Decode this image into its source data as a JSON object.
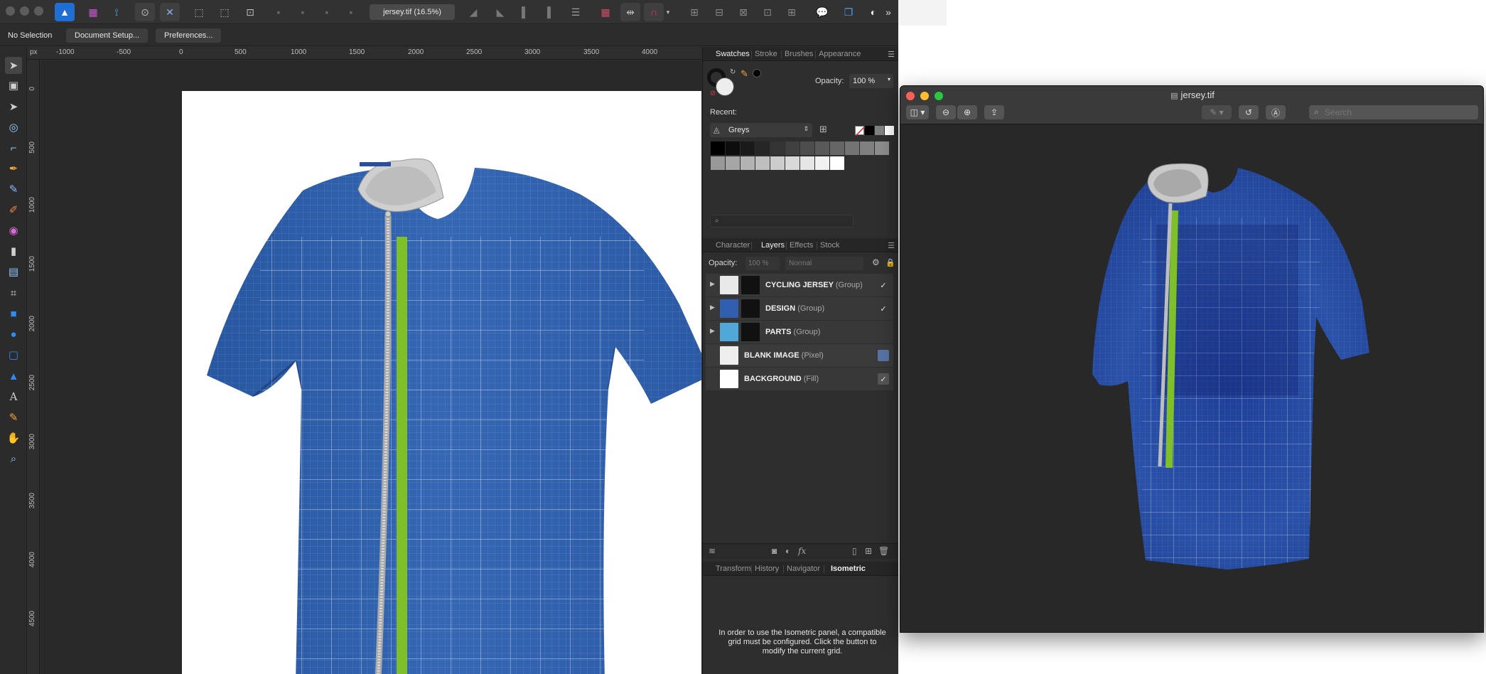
{
  "topbar": {
    "doc_tab": "jersey.tif (16.5%)"
  },
  "context": {
    "selection": "No Selection",
    "document_setup": "Document Setup...",
    "preferences": "Preferences..."
  },
  "rulers": {
    "unit": "px",
    "top": [
      "-1000",
      "-500",
      "0",
      "500",
      "1000",
      "1500",
      "2000",
      "2500",
      "3000",
      "3500",
      "4000"
    ],
    "left": [
      "0",
      "500",
      "1000",
      "1500",
      "2000",
      "2500",
      "3000",
      "3500",
      "4000",
      "4500"
    ]
  },
  "swatches_panel": {
    "tabs": [
      "Swatches",
      "Stroke",
      "Brushes",
      "Appearance"
    ],
    "active_tab": "Swatches",
    "opacity_label": "Opacity:",
    "opacity_value": "100 %",
    "recent_label": "Recent:",
    "palette_name": "Greys",
    "grey_swatches": [
      "#000000",
      "#0d0d0d",
      "#1a1a1a",
      "#262626",
      "#333333",
      "#404040",
      "#4d4d4d",
      "#595959",
      "#666666",
      "#737373",
      "#808080",
      "#8c8c8c",
      "#999999",
      "#a6a6a6",
      "#b3b3b3",
      "#bfbfbf",
      "#cccccc",
      "#d9d9d9",
      "#e6e6e6",
      "#f2f2f2",
      "#ffffff"
    ]
  },
  "layers_panel": {
    "tabs": [
      "Character",
      "Layers",
      "Effects",
      "Stock"
    ],
    "active_tab": "Layers",
    "opacity_label": "Opacity:",
    "opacity_value": "100 %",
    "blend_mode": "Normal",
    "layers": [
      {
        "name": "CYCLING JERSEY",
        "type": "(Group)",
        "visible": "✓"
      },
      {
        "name": "DESIGN",
        "type": "(Group)",
        "visible": "✓"
      },
      {
        "name": "PARTS",
        "type": "(Group)",
        "visible": ""
      },
      {
        "name": "BLANK IMAGE",
        "type": "(Pixel)",
        "visible": ""
      },
      {
        "name": "BACKGROUND",
        "type": "(Fill)",
        "visible": "✓"
      }
    ]
  },
  "bottom_panel": {
    "tabs": [
      "Transform",
      "History",
      "Navigator",
      "Isometric"
    ],
    "active_tab": "Isometric",
    "message": "In order to use the Isometric panel, a compatible grid must be configured. Click the button to modify the current grid."
  },
  "preview": {
    "title": "jersey.tif",
    "search_placeholder": "Search"
  },
  "colors": {
    "jersey_blue": "#2f5fae",
    "jersey_dark": "#1c3578",
    "stripe_green": "#7fbf2a",
    "zip_grey": "#b7b7b7",
    "traffic_red": "#fe5f57",
    "traffic_yellow": "#febc2e",
    "traffic_green": "#28c840"
  }
}
